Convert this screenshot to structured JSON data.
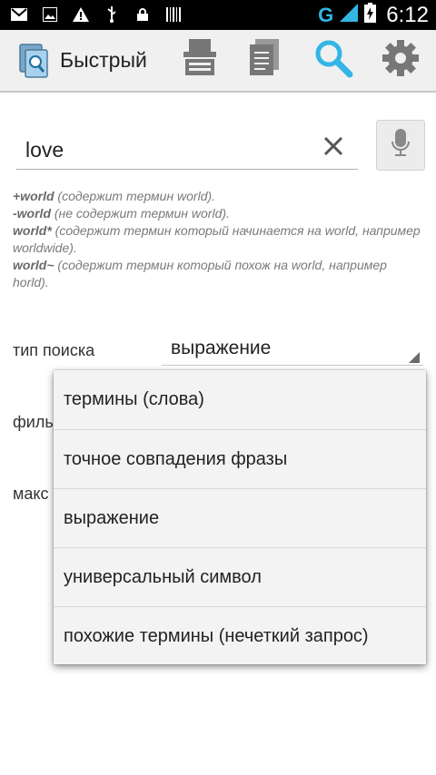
{
  "statusbar": {
    "network": "G",
    "time": "6:12"
  },
  "actionbar": {
    "title": "Быстрый",
    "icons": [
      "book-search-icon",
      "scanner-icon",
      "document-icon",
      "search-icon",
      "settings-icon"
    ],
    "accent_color": "#33b5e5"
  },
  "search": {
    "value": "love"
  },
  "hints": [
    {
      "term": "+world",
      "desc": " (содержит термин world)."
    },
    {
      "term": "-world",
      "desc": " (не содержит термин world)."
    },
    {
      "term": "world*",
      "desc": " (содержит термин который начинается на world, например worldwide)."
    },
    {
      "term": "world~",
      "desc": " (содержит термин который похож на world, например horld)."
    }
  ],
  "form": {
    "search_type_label": "тип поиска",
    "search_type_value": "выражение",
    "filter_label": "филь",
    "max_label": "макс"
  },
  "dropdown": {
    "options": [
      "термины (слова)",
      "точное совпадения фразы",
      "выражение",
      "универсальный символ",
      "похожие термины (нечеткий запрос)"
    ]
  }
}
